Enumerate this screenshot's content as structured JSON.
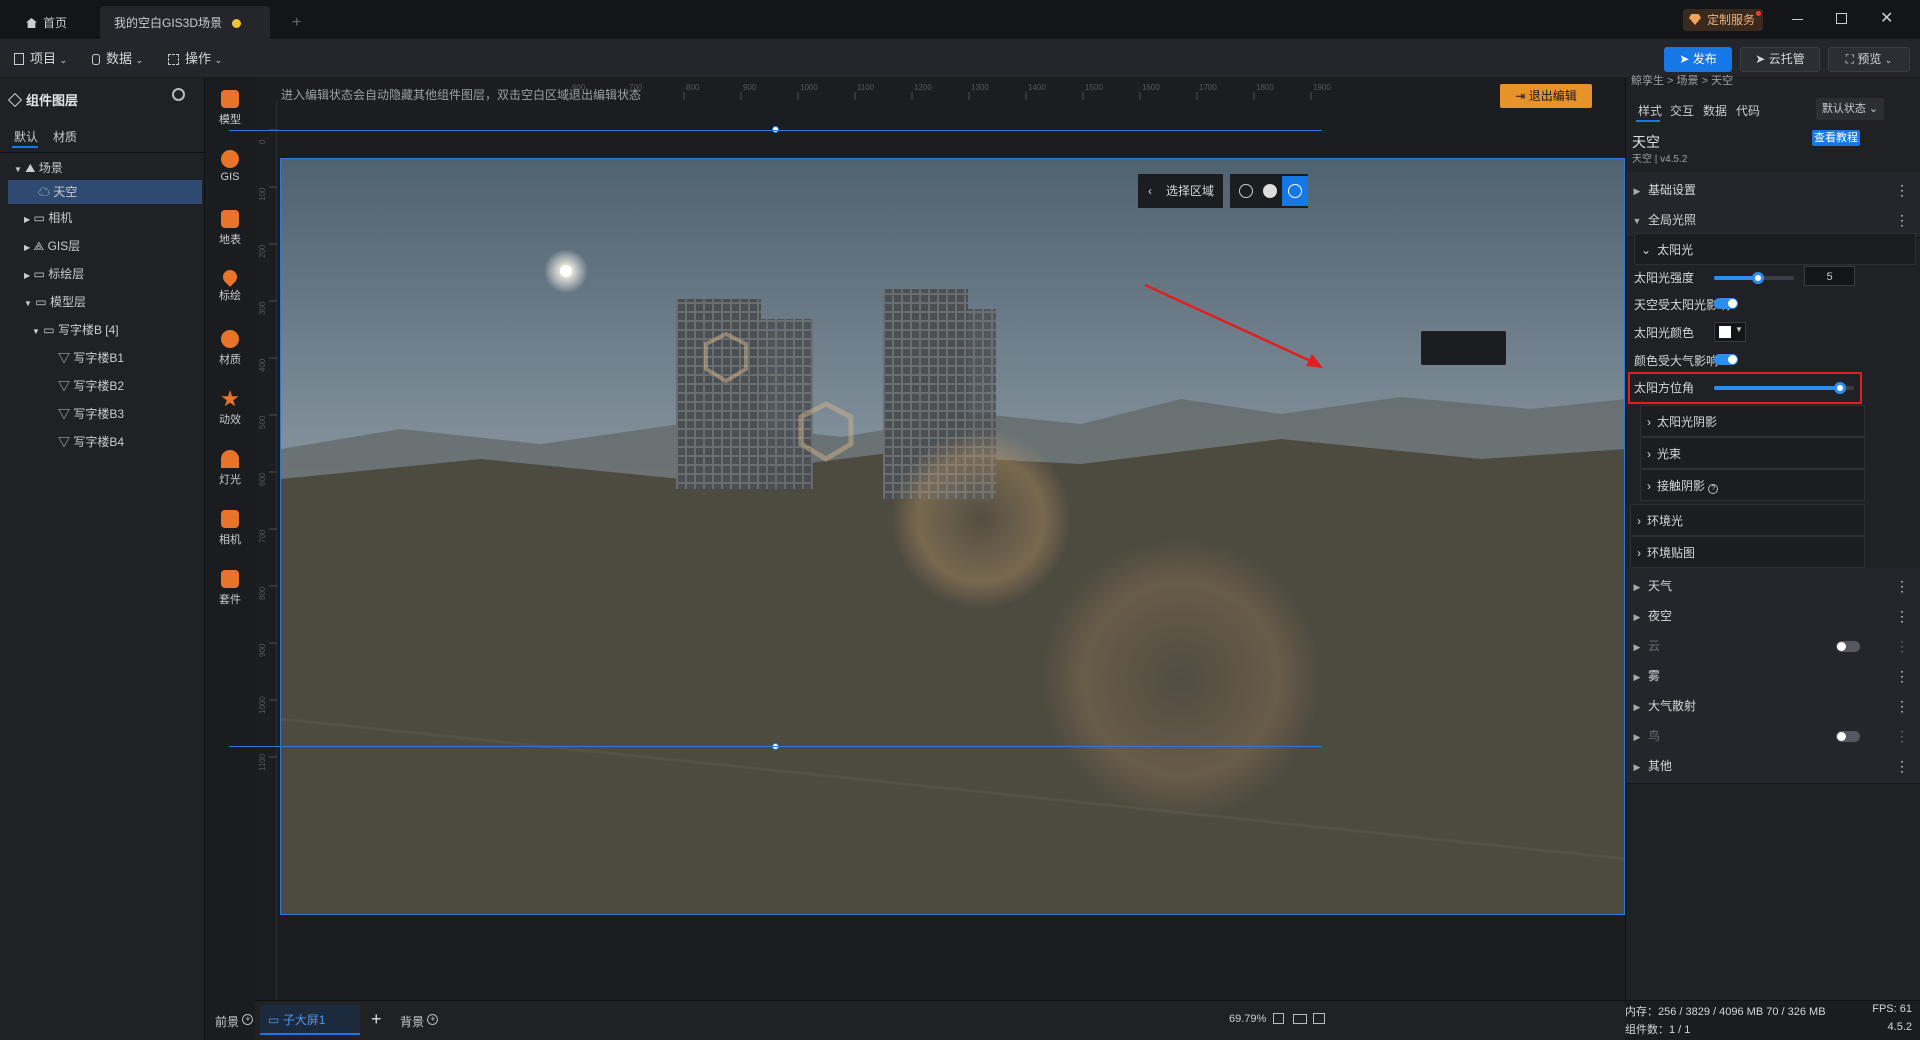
{
  "tabs": {
    "home": "首页",
    "scene": "我的空白GIS3D场景",
    "new_tab": "+"
  },
  "topright": {
    "custom_service": "定制服务"
  },
  "menu": {
    "project": "项目",
    "data": "数据",
    "operate": "操作"
  },
  "actions": {
    "publish": "发布",
    "cloud": "云托管",
    "preview": "预览"
  },
  "left": {
    "title": "组件图层",
    "tabs": [
      "默认",
      "材质"
    ],
    "tree": [
      {
        "label": "场景"
      },
      {
        "label": "天空"
      },
      {
        "label": "相机"
      },
      {
        "label": "GIS层"
      },
      {
        "label": "标绘层"
      },
      {
        "label": "模型层"
      },
      {
        "label": "写字楼B [4]"
      },
      {
        "label": "写字楼B1"
      },
      {
        "label": "写字楼B2"
      },
      {
        "label": "写字楼B3"
      },
      {
        "label": "写字楼B4"
      }
    ]
  },
  "tools": [
    "模型",
    "GIS",
    "地表",
    "标绘",
    "材质",
    "动效",
    "灯光",
    "相机",
    "套件"
  ],
  "canvas": {
    "hint": "进入编辑状态会自动隐藏其他组件图层，双击空白区域退出编辑状态",
    "exit_edit": "退出编辑",
    "select_area": "选择区域",
    "ruler_top": [
      "600",
      "700",
      "800",
      "900",
      "1000",
      "1100",
      "1200",
      "1300",
      "1400",
      "1500",
      "1600",
      "1700",
      "1800",
      "1900"
    ],
    "ruler_left": [
      "0",
      "100",
      "200",
      "300",
      "400",
      "500",
      "600",
      "700",
      "800",
      "900",
      "1000",
      "1100"
    ]
  },
  "bottom": {
    "front": "前景",
    "screen": "子大屏1",
    "add": "+",
    "back": "背景",
    "zoom": "69.79%"
  },
  "right": {
    "breadcrumb": "鲸孪生 > 场景 > 天空",
    "tabs": [
      "样式",
      "交互",
      "数据",
      "代码"
    ],
    "state": "默认状态",
    "comp_title": "天空",
    "comp_version": "天空 | v4.5.2",
    "tutorial": "查看教程",
    "sections": {
      "basic": "基础设置",
      "global_light": "全局光照",
      "sunlight": "太阳光",
      "sun_intensity": "太阳光强度",
      "sun_intensity_value": "5",
      "sky_affected": "天空受太阳光影响",
      "sun_color": "太阳光颜色",
      "color_affected": "颜色受大气影响",
      "sun_azimuth": "太阳方位角",
      "sun_shadow": "太阳光阴影",
      "beam": "光束",
      "contact_shadow": "接触阴影",
      "env_light": "环境光",
      "env_map": "环境贴图",
      "weather": "天气",
      "night": "夜空",
      "cloud": "云",
      "fog": "雾",
      "scatter": "大气散射",
      "bird": "鸟",
      "other": "其他"
    },
    "slider_levels": {
      "sun_intensity": 0.55,
      "sun_azimuth": 0.9
    }
  },
  "status": {
    "memory": "内存：256 / 3829 / 4096 MB  70 / 326 MB",
    "fps": "FPS:  61",
    "count": "组件数：1 / 1",
    "version": "4.5.2"
  },
  "colors": {
    "accent": "#1677e6",
    "highlight": "#e02020",
    "exit": "#e8922a"
  }
}
